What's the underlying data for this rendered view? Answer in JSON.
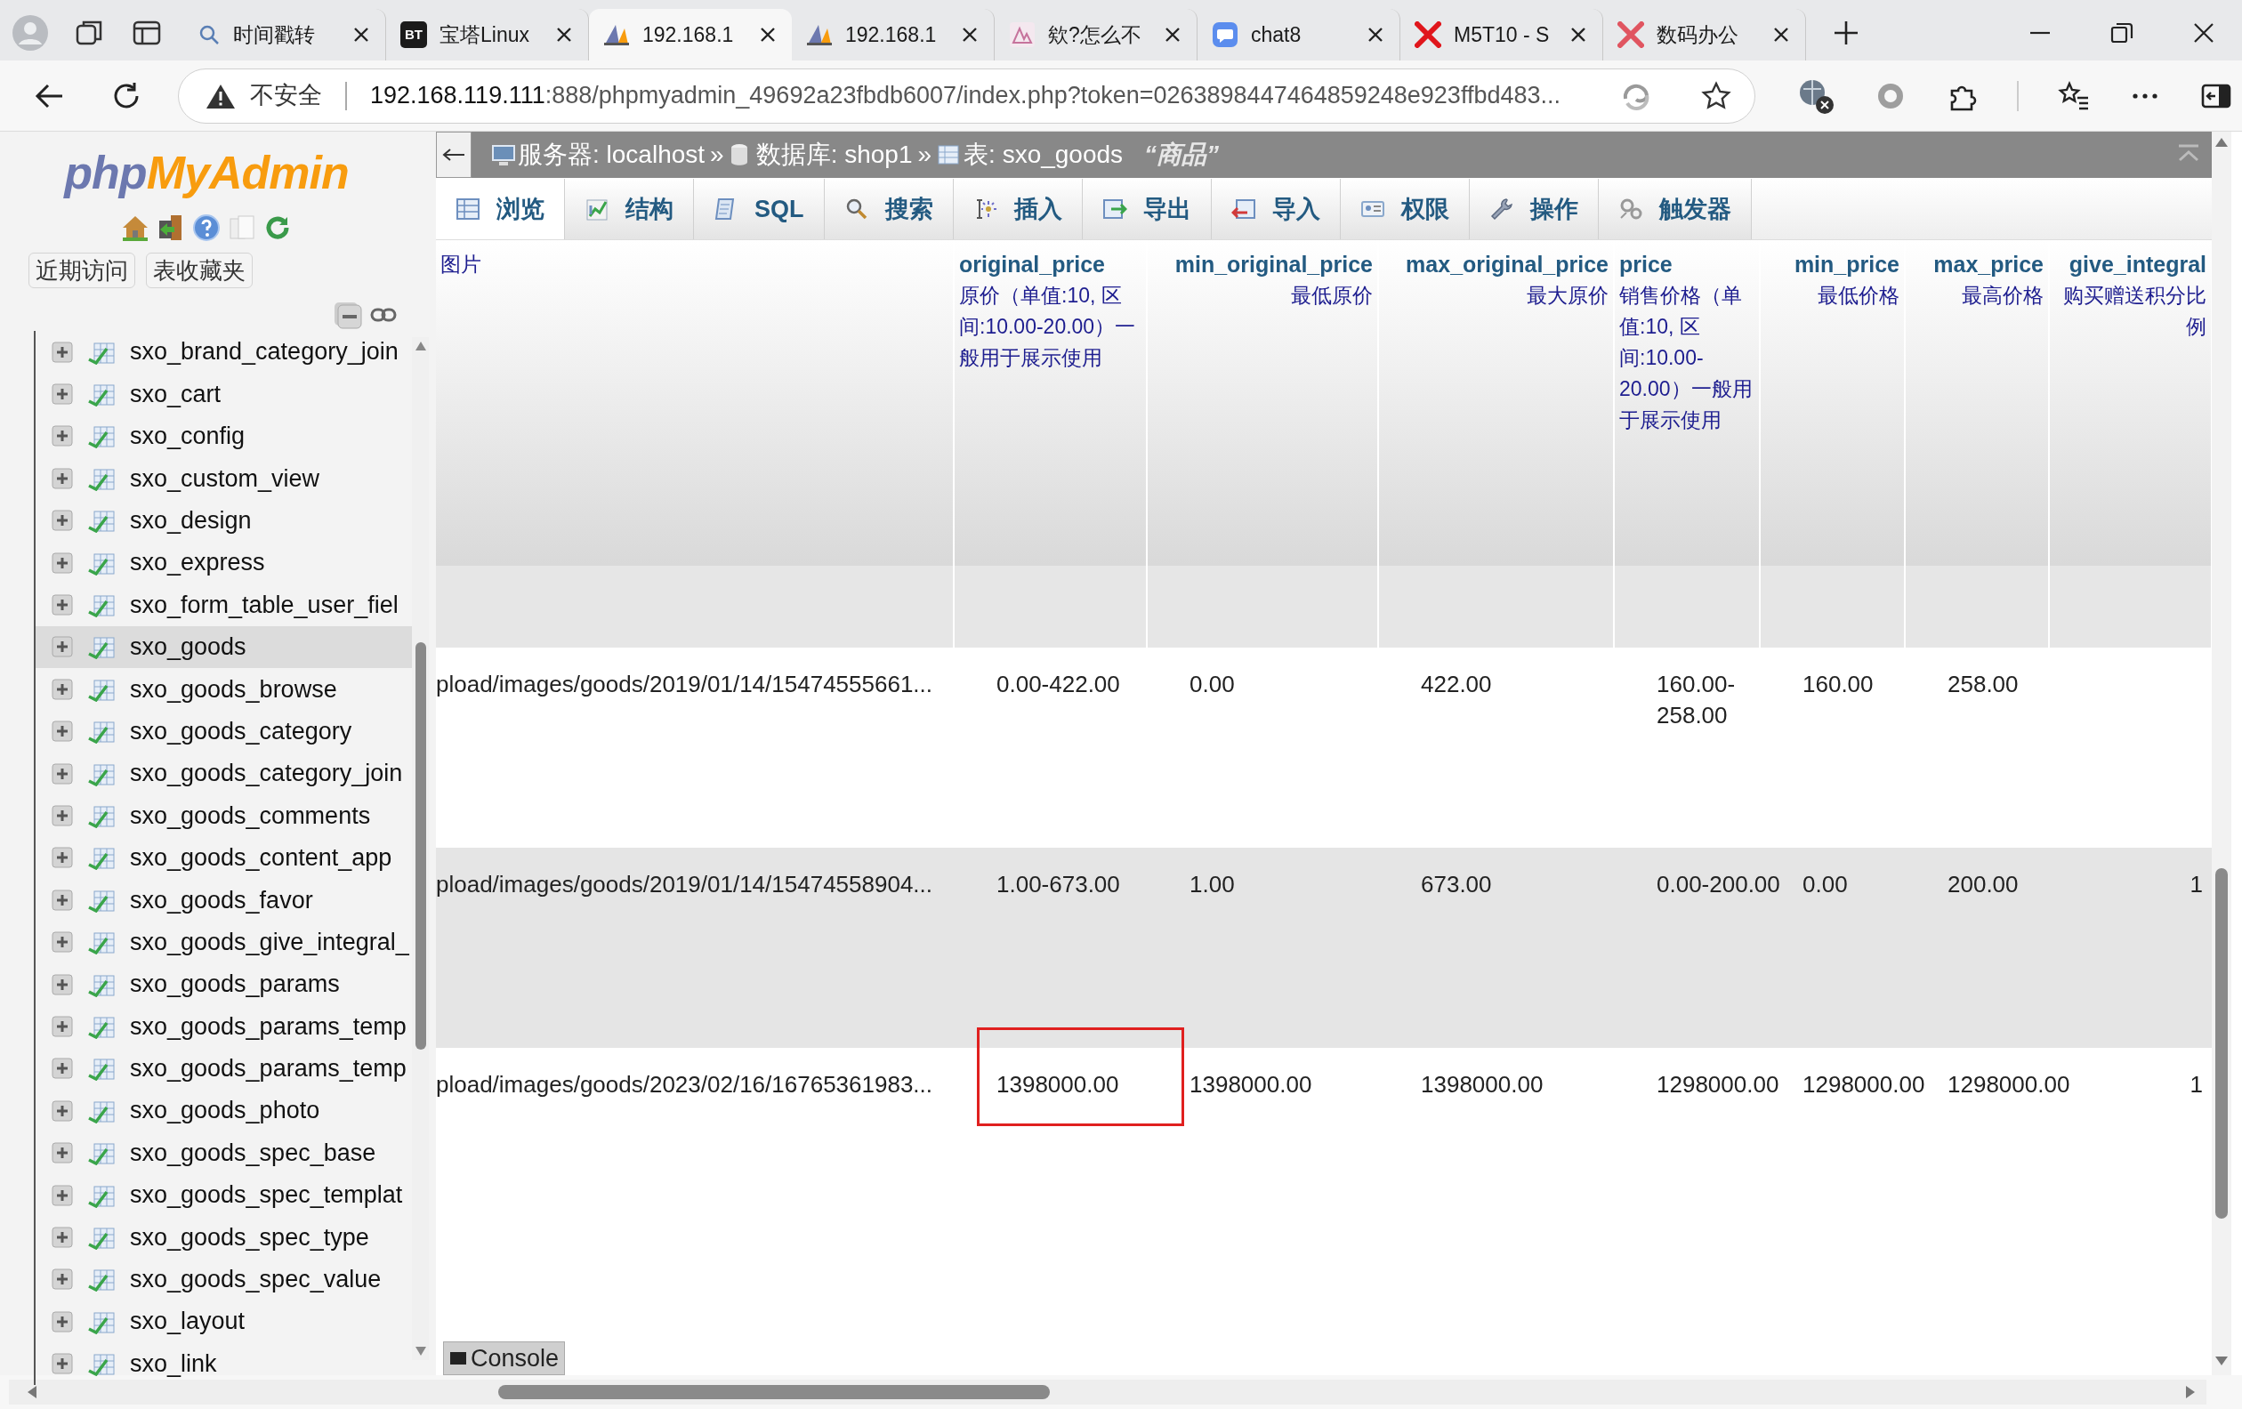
{
  "browser": {
    "tabs": [
      {
        "title": "时间戳转",
        "kind": "search",
        "selected": false
      },
      {
        "title": "宝塔Linux",
        "kind": "badge",
        "badge": "BT",
        "selected": false
      },
      {
        "title": "192.168.1",
        "kind": "pma",
        "selected": true
      },
      {
        "title": "192.168.1",
        "kind": "pma",
        "selected": false
      },
      {
        "title": "欸?怎么不",
        "kind": "image",
        "selected": false
      },
      {
        "title": "chat8",
        "kind": "chat",
        "selected": false
      },
      {
        "title": "M5T10 - S",
        "kind": "x",
        "selected": false
      },
      {
        "title": "数码办公",
        "kind": "x",
        "selected": false
      }
    ],
    "address": {
      "security": "不安全",
      "host": "192.168.119.111",
      "path": ":888/phpmyadmin_49692a23fbdb6007/index.php?token=0263898447464859248e923ffbd483..."
    }
  },
  "sidebar": {
    "logo": {
      "first": "php",
      "second": "MyAdmin"
    },
    "buttons": [
      "近期访问",
      "表收藏夹"
    ],
    "tables": [
      {
        "name": "sxo_brand_category_join",
        "selected": false
      },
      {
        "name": "sxo_cart",
        "selected": false
      },
      {
        "name": "sxo_config",
        "selected": false
      },
      {
        "name": "sxo_custom_view",
        "selected": false
      },
      {
        "name": "sxo_design",
        "selected": false
      },
      {
        "name": "sxo_express",
        "selected": false
      },
      {
        "name": "sxo_form_table_user_fiel",
        "selected": false
      },
      {
        "name": "sxo_goods",
        "selected": true
      },
      {
        "name": "sxo_goods_browse",
        "selected": false
      },
      {
        "name": "sxo_goods_category",
        "selected": false
      },
      {
        "name": "sxo_goods_category_join",
        "selected": false
      },
      {
        "name": "sxo_goods_comments",
        "selected": false
      },
      {
        "name": "sxo_goods_content_app",
        "selected": false
      },
      {
        "name": "sxo_goods_favor",
        "selected": false
      },
      {
        "name": "sxo_goods_give_integral_",
        "selected": false
      },
      {
        "name": "sxo_goods_params",
        "selected": false
      },
      {
        "name": "sxo_goods_params_temp",
        "selected": false
      },
      {
        "name": "sxo_goods_params_temp",
        "selected": false
      },
      {
        "name": "sxo_goods_photo",
        "selected": false
      },
      {
        "name": "sxo_goods_spec_base",
        "selected": false
      },
      {
        "name": "sxo_goods_spec_templat",
        "selected": false
      },
      {
        "name": "sxo_goods_spec_type",
        "selected": false
      },
      {
        "name": "sxo_goods_spec_value",
        "selected": false
      },
      {
        "name": "sxo_layout",
        "selected": false
      },
      {
        "name": "sxo_link",
        "selected": false
      }
    ]
  },
  "breadcrumb": {
    "items": [
      {
        "kind": "server",
        "label": "服务器: localhost",
        "separator": "»"
      },
      {
        "kind": "database",
        "label": "数据库: shop1",
        "separator": "»"
      },
      {
        "kind": "table",
        "label": "表: sxo_goods"
      }
    ],
    "comment": "“商品”"
  },
  "menu_tabs": [
    {
      "label": "浏览",
      "kind": "browse",
      "selected": true
    },
    {
      "label": "结构",
      "kind": "structure",
      "selected": false
    },
    {
      "label": "SQL",
      "kind": "sql",
      "selected": false
    },
    {
      "label": "搜索",
      "kind": "search",
      "selected": false
    },
    {
      "label": "插入",
      "kind": "insert",
      "selected": false
    },
    {
      "label": "导出",
      "kind": "export",
      "selected": false
    },
    {
      "label": "导入",
      "kind": "import",
      "selected": false
    },
    {
      "label": "权限",
      "kind": "privileges",
      "selected": false
    },
    {
      "label": "操作",
      "kind": "operations",
      "selected": false
    },
    {
      "label": "触发器",
      "kind": "triggers",
      "selected": false
    }
  ],
  "table": {
    "columns": [
      {
        "comment": "图片"
      },
      {
        "name": "original_price",
        "comment": "原价（单值:10, 区间:10.00-20.00）一般用于展示使用"
      },
      {
        "name": "min_original_price",
        "comment": "最低原价"
      },
      {
        "name": "max_original_price",
        "comment": "最大原价"
      },
      {
        "name": "price",
        "comment": "销售价格（单值:10, 区间:10.00-20.00）一般用于展示使用"
      },
      {
        "name": "min_price",
        "comment": "最低价格"
      },
      {
        "name": "max_price",
        "comment": "最高价格"
      },
      {
        "name": "give_integral",
        "comment": "购买赠送积分比例"
      }
    ],
    "rows": [
      {
        "cells": [
          {
            "text": "pload/images/goods/2019/01/14/15474555661...",
            "highlighted": false
          },
          {
            "text": "0.00-422.00",
            "highlighted": false
          },
          {
            "text": "0.00",
            "highlighted": false
          },
          {
            "text": "422.00",
            "highlighted": false
          },
          {
            "text": "160.00-258.00",
            "highlighted": false
          },
          {
            "text": "160.00",
            "highlighted": false
          },
          {
            "text": "258.00",
            "highlighted": false
          }
        ]
      },
      {
        "cells": [
          {
            "text": "pload/images/goods/2019/01/14/15474558904...",
            "highlighted": false
          },
          {
            "text": "1.00-673.00",
            "highlighted": false
          },
          {
            "text": "1.00",
            "highlighted": false
          },
          {
            "text": "673.00",
            "highlighted": false
          },
          {
            "text": "0.00-200.00",
            "highlighted": false
          },
          {
            "text": "0.00",
            "highlighted": false
          },
          {
            "text": "200.00",
            "highlighted": false
          },
          {
            "text": "1",
            "highlighted": false
          }
        ]
      },
      {
        "cells": [
          {
            "text": "pload/images/goods/2023/02/16/16765361983...",
            "highlighted": false
          },
          {
            "text": "1398000.00",
            "highlighted": true
          },
          {
            "text": "1398000.00",
            "highlighted": false
          },
          {
            "text": "1398000.00",
            "highlighted": false
          },
          {
            "text": "1298000.00",
            "highlighted": false
          },
          {
            "text": "1298000.00",
            "highlighted": false
          },
          {
            "text": "1298000.00",
            "highlighted": false
          },
          {
            "text": "1",
            "highlighted": false
          }
        ]
      }
    ]
  },
  "console": {
    "label": "Console"
  }
}
